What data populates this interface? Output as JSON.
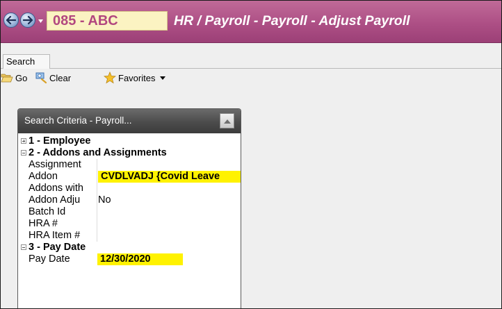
{
  "titlebar": {
    "back_icon": "back-arrow-icon",
    "forward_icon": "forward-arrow-icon",
    "company_code": "085 - ABC",
    "title": "HR / Payroll - Payroll - Adjust Payroll",
    "colors": {
      "bar": "#ad4f85",
      "company_bg": "#fbf3c2",
      "company_text": "#b2477f"
    }
  },
  "tabs": [
    {
      "label": "Search",
      "selected": true
    }
  ],
  "toolbar": {
    "go_label": "Go",
    "clear_label": "Clear",
    "favorites_label": "Favorites",
    "icons": {
      "go": "folder-open-icon",
      "clear": "clear-search-icon",
      "favorites": "star-icon"
    }
  },
  "search_panel": {
    "title": "Search Criteria - Payroll...",
    "groups": [
      {
        "label": "1 - Employee",
        "expanded": false
      },
      {
        "label": "2 - Addons and Assignments",
        "expanded": true,
        "fields": [
          {
            "label": "Assignment",
            "value": ""
          },
          {
            "label": "Addon",
            "value": "CVDLVADJ {Covid Leave",
            "highlighted": true
          },
          {
            "label": "Addons with",
            "value": ""
          },
          {
            "label": "Addon Adju",
            "value": "No"
          },
          {
            "label": "Batch Id",
            "value": ""
          },
          {
            "label": "HRA #",
            "value": ""
          },
          {
            "label": "HRA Item #",
            "value": ""
          }
        ]
      },
      {
        "label": "3 - Pay Date",
        "expanded": true,
        "fields": [
          {
            "label": "Pay Date",
            "value": "12/30/2020",
            "highlighted": true
          }
        ]
      }
    ],
    "highlight_color": "#fff200"
  }
}
